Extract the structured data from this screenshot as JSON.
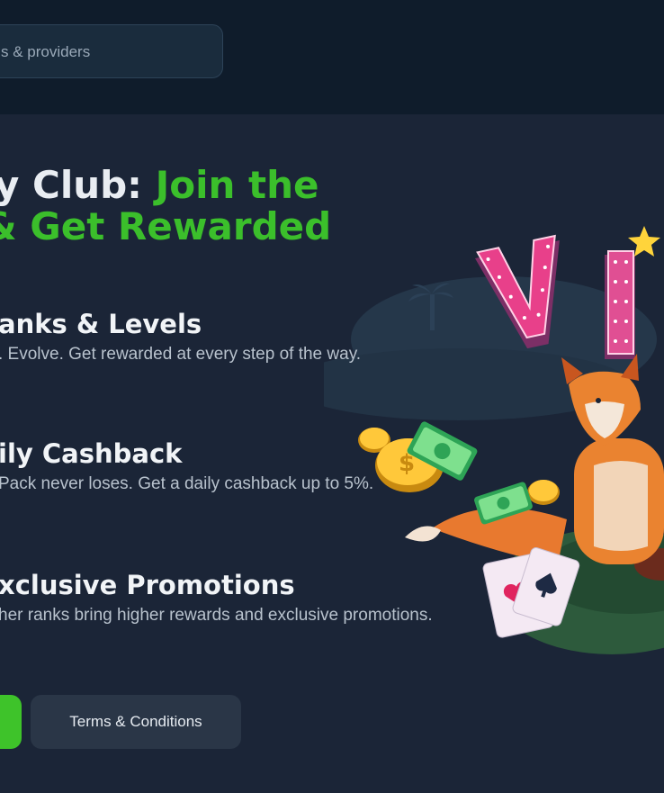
{
  "search": {
    "placeholder": "s & providers"
  },
  "hero": {
    "title_line1_white": "y Club: ",
    "title_line1_green": "Join the",
    "title_line2_white": "& ",
    "title_line2_green": "Get Rewarded"
  },
  "features": [
    {
      "title": "anks & Levels",
      "desc": ". Evolve. Get rewarded at every step of the way."
    },
    {
      "title": "ily Cashback",
      "desc": " Pack never loses. Get a daily cashback up to 5%."
    },
    {
      "title": "xclusive Promotions",
      "desc": "her ranks bring higher rewards and exclusive promotions."
    }
  ],
  "buttons": {
    "terms_label": "Terms & Conditions"
  },
  "art": {
    "vip_text": "VI"
  },
  "colors": {
    "accent_green": "#3bbf2b",
    "background": "#1b2537",
    "topbar": "#0f1c2b"
  }
}
